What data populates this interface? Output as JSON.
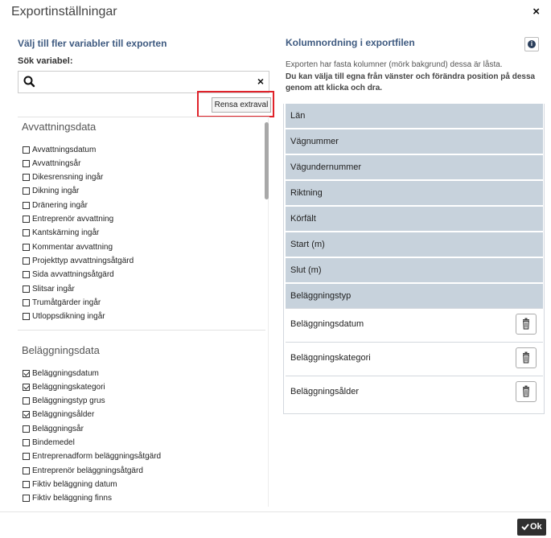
{
  "modal": {
    "title": "Exportinställningar",
    "close_glyph": "×"
  },
  "left": {
    "title": "Välj till fler variabler till exporten",
    "search_label": "Sök variabel:",
    "search_value": "",
    "clear_glyph": "×",
    "rensa_label": "Rensa extraval",
    "groups": [
      {
        "title": "Avvattningsdata",
        "items": [
          {
            "label": "Avvattningsdatum",
            "checked": false
          },
          {
            "label": "Avvattningsår",
            "checked": false
          },
          {
            "label": "Dikesrensning ingår",
            "checked": false
          },
          {
            "label": "Dikning ingår",
            "checked": false
          },
          {
            "label": "Dränering ingår",
            "checked": false
          },
          {
            "label": "Entreprenör avvattning",
            "checked": false
          },
          {
            "label": "Kantskärning ingår",
            "checked": false
          },
          {
            "label": "Kommentar avvattning",
            "checked": false
          },
          {
            "label": "Projekttyp avvattningsåtgärd",
            "checked": false
          },
          {
            "label": "Sida avvattningsåtgärd",
            "checked": false
          },
          {
            "label": "Slitsar ingår",
            "checked": false
          },
          {
            "label": "Trumåtgärder ingår",
            "checked": false
          },
          {
            "label": "Utloppsdikning ingår",
            "checked": false
          }
        ]
      },
      {
        "title": "Beläggningsdata",
        "items": [
          {
            "label": "Beläggningsdatum",
            "checked": true
          },
          {
            "label": "Beläggningskategori",
            "checked": true
          },
          {
            "label": "Beläggningstyp grus",
            "checked": false
          },
          {
            "label": "Beläggningsålder",
            "checked": true
          },
          {
            "label": "Beläggningsår",
            "checked": false
          },
          {
            "label": "Bindemedel",
            "checked": false
          },
          {
            "label": "Entreprenadform beläggningsåtgärd",
            "checked": false
          },
          {
            "label": "Entreprenör beläggningsåtgärd",
            "checked": false
          },
          {
            "label": "Fiktiv beläggning datum",
            "checked": false
          },
          {
            "label": "Fiktiv beläggning finns",
            "checked": false
          }
        ]
      }
    ]
  },
  "right": {
    "title": "Kolumnordning i exportfilen",
    "info_glyph": "i",
    "desc_line1": "Exporten har fasta kolumner (mörk bakgrund) dessa är låsta.",
    "desc_line2": "Du kan välja till egna från vänster och förändra position på dessa genom att klicka och dra.",
    "fixed_columns": [
      "Län",
      "Vägnummer",
      "Vägundernummer",
      "Riktning",
      "Körfält",
      "Start (m)",
      "Slut (m)",
      "Beläggningstyp"
    ],
    "extra_columns": [
      "Beläggningsdatum",
      "Beläggningskategori",
      "Beläggningsålder"
    ]
  },
  "footer": {
    "ok_label": "Ok"
  },
  "colors": {
    "accent_title": "#3e5a80",
    "fixed_bg": "#c7d2dc",
    "highlight": "#e0222a",
    "ok_bg": "#2f2f2f"
  }
}
